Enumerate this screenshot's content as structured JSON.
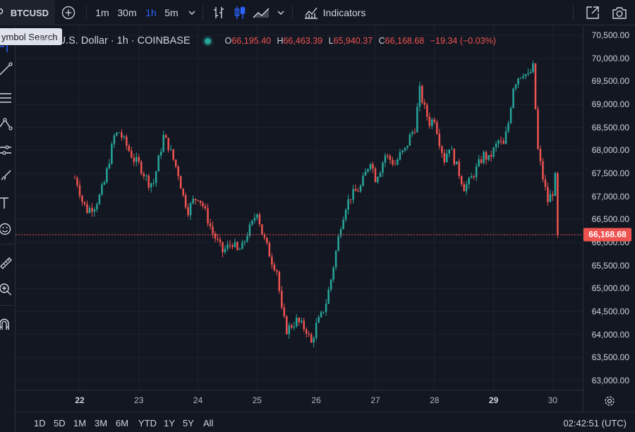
{
  "toolbar": {
    "symbol": "BTCUSD",
    "intervals": [
      "1m",
      "30m",
      "1h",
      "5m"
    ],
    "active_interval": "1h",
    "indicators_label": "Indicators"
  },
  "tooltip": {
    "text": "ymbol Search"
  },
  "legend": {
    "title": "coin / U.S. Dollar · 1h · COINBASE",
    "open_key": "O",
    "open": "66,195.40",
    "high_key": "H",
    "high": "66,463.39",
    "low_key": "L",
    "low": "65,940.37",
    "close_key": "C",
    "close": "66,168.68",
    "change": "−19.34 (−0.03%)"
  },
  "price_axis": {
    "labels": [
      "70,500.00",
      "70,000.00",
      "69,500.00",
      "69,000.00",
      "68,500.00",
      "68,000.00",
      "67,500.00",
      "67,000.00",
      "66,500.00",
      "66,000.00",
      "65,500.00",
      "65,000.00",
      "64,500.00",
      "64,000.00",
      "63,500.00",
      "63,000.00"
    ],
    "current_price": "66,168.68"
  },
  "time_axis": {
    "labels": [
      "22",
      "23",
      "24",
      "25",
      "26",
      "27",
      "28",
      "29",
      "30"
    ],
    "bold_labels": [
      "22",
      "29"
    ]
  },
  "range_buttons": [
    "1D",
    "5D",
    "1M",
    "3M",
    "6M",
    "YTD",
    "1Y",
    "5Y",
    "All"
  ],
  "clock": "02:42:51 (UTC)",
  "colors": {
    "up": "#26a69a",
    "down": "#ef5350",
    "accent": "#2962ff",
    "background": "#131722"
  },
  "chart_data": {
    "type": "candlestick",
    "ylim": [
      62800,
      70700
    ],
    "current_price": 66168.68,
    "close_path": [
      [
        "21 22:00",
        67400
      ],
      [
        "21 23:00",
        67300
      ],
      [
        "22 01:00",
        66900
      ],
      [
        "22 03:00",
        66700
      ],
      [
        "22 06:00",
        66800
      ],
      [
        "22 08:00",
        67000
      ],
      [
        "22 10:00",
        67300
      ],
      [
        "22 12:00",
        67800
      ],
      [
        "22 14:00",
        68300
      ],
      [
        "22 16:00",
        68400
      ],
      [
        "22 18:00",
        68200
      ],
      [
        "22 20:00",
        68000
      ],
      [
        "22 22:00",
        67800
      ],
      [
        "23 00:00",
        67700
      ],
      [
        "23 02:00",
        67500
      ],
      [
        "23 04:00",
        67300
      ],
      [
        "23 06:00",
        67300
      ],
      [
        "23 08:00",
        67800
      ],
      [
        "23 10:00",
        68300
      ],
      [
        "23 12:00",
        68100
      ],
      [
        "23 14:00",
        67800
      ],
      [
        "23 16:00",
        67500
      ],
      [
        "23 18:00",
        67000
      ],
      [
        "23 20:00",
        66700
      ],
      [
        "23 22:00",
        66900
      ],
      [
        "24 00:00",
        67000
      ],
      [
        "24 02:00",
        66800
      ],
      [
        "24 04:00",
        66500
      ],
      [
        "24 06:00",
        66200
      ],
      [
        "24 08:00",
        66000
      ],
      [
        "24 10:00",
        65800
      ],
      [
        "24 12:00",
        65900
      ],
      [
        "24 14:00",
        66000
      ],
      [
        "24 16:00",
        65800
      ],
      [
        "24 18:00",
        65900
      ],
      [
        "24 20:00",
        66200
      ],
      [
        "24 22:00",
        66400
      ],
      [
        "25 00:00",
        66700
      ],
      [
        "25 02:00",
        66200
      ],
      [
        "25 04:00",
        65900
      ],
      [
        "25 06:00",
        65600
      ],
      [
        "25 08:00",
        65400
      ],
      [
        "25 10:00",
        64500
      ],
      [
        "25 12:00",
        64100
      ],
      [
        "25 14:00",
        64200
      ],
      [
        "25 16:00",
        64300
      ],
      [
        "25 18:00",
        64200
      ],
      [
        "25 20:00",
        64100
      ],
      [
        "25 22:00",
        63800
      ],
      [
        "26 00:00",
        64200
      ],
      [
        "26 02:00",
        64400
      ],
      [
        "26 04:00",
        64700
      ],
      [
        "26 06:00",
        65200
      ],
      [
        "26 08:00",
        65800
      ],
      [
        "26 10:00",
        66400
      ],
      [
        "26 12:00",
        66800
      ],
      [
        "26 14:00",
        67000
      ],
      [
        "26 16:00",
        67100
      ],
      [
        "26 18:00",
        67200
      ],
      [
        "26 20:00",
        67500
      ],
      [
        "26 22:00",
        67800
      ],
      [
        "27 00:00",
        67400
      ],
      [
        "27 02:00",
        67600
      ],
      [
        "27 04:00",
        67900
      ],
      [
        "27 06:00",
        67800
      ],
      [
        "27 08:00",
        67700
      ],
      [
        "27 10:00",
        67900
      ],
      [
        "27 12:00",
        68000
      ],
      [
        "27 14:00",
        68300
      ],
      [
        "27 16:00",
        68500
      ],
      [
        "27 18:00",
        69300
      ],
      [
        "27 20:00",
        68900
      ],
      [
        "27 22:00",
        68600
      ],
      [
        "28 00:00",
        68700
      ],
      [
        "28 02:00",
        68200
      ],
      [
        "28 04:00",
        67800
      ],
      [
        "28 06:00",
        68100
      ],
      [
        "28 08:00",
        67800
      ],
      [
        "28 10:00",
        67500
      ],
      [
        "28 12:00",
        67200
      ],
      [
        "28 14:00",
        67300
      ],
      [
        "28 16:00",
        67500
      ],
      [
        "28 18:00",
        67700
      ],
      [
        "28 20:00",
        67900
      ],
      [
        "28 22:00",
        67800
      ],
      [
        "29 00:00",
        68000
      ],
      [
        "29 02:00",
        68200
      ],
      [
        "29 04:00",
        68100
      ],
      [
        "29 06:00",
        68600
      ],
      [
        "29 08:00",
        69400
      ],
      [
        "29 10:00",
        69600
      ],
      [
        "29 12:00",
        69700
      ],
      [
        "29 14:00",
        69600
      ],
      [
        "29 16:00",
        69800
      ],
      [
        "29 18:00",
        68000
      ],
      [
        "29 20:00",
        67400
      ],
      [
        "29 22:00",
        66900
      ],
      [
        "30 00:00",
        67100
      ],
      [
        "30 01:00",
        67400
      ],
      [
        "30 02:00",
        66500
      ],
      [
        "30 02:42",
        66168.68
      ]
    ]
  }
}
